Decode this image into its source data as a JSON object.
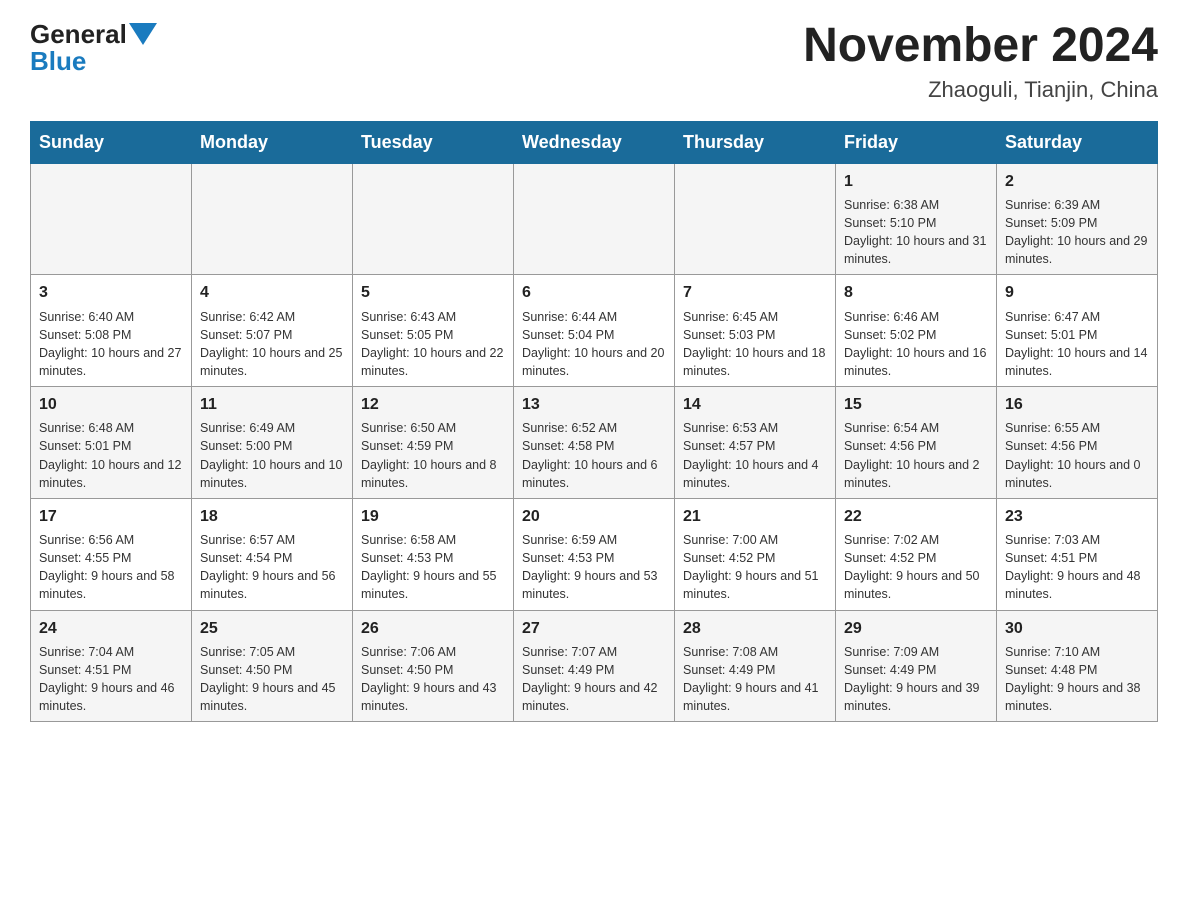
{
  "header": {
    "logo_line1": "General",
    "logo_line2": "Blue",
    "month_title": "November 2024",
    "location": "Zhaoguli, Tianjin, China"
  },
  "days_of_week": [
    "Sunday",
    "Monday",
    "Tuesday",
    "Wednesday",
    "Thursday",
    "Friday",
    "Saturday"
  ],
  "weeks": [
    [
      {
        "day": "",
        "info": ""
      },
      {
        "day": "",
        "info": ""
      },
      {
        "day": "",
        "info": ""
      },
      {
        "day": "",
        "info": ""
      },
      {
        "day": "",
        "info": ""
      },
      {
        "day": "1",
        "info": "Sunrise: 6:38 AM\nSunset: 5:10 PM\nDaylight: 10 hours and 31 minutes."
      },
      {
        "day": "2",
        "info": "Sunrise: 6:39 AM\nSunset: 5:09 PM\nDaylight: 10 hours and 29 minutes."
      }
    ],
    [
      {
        "day": "3",
        "info": "Sunrise: 6:40 AM\nSunset: 5:08 PM\nDaylight: 10 hours and 27 minutes."
      },
      {
        "day": "4",
        "info": "Sunrise: 6:42 AM\nSunset: 5:07 PM\nDaylight: 10 hours and 25 minutes."
      },
      {
        "day": "5",
        "info": "Sunrise: 6:43 AM\nSunset: 5:05 PM\nDaylight: 10 hours and 22 minutes."
      },
      {
        "day": "6",
        "info": "Sunrise: 6:44 AM\nSunset: 5:04 PM\nDaylight: 10 hours and 20 minutes."
      },
      {
        "day": "7",
        "info": "Sunrise: 6:45 AM\nSunset: 5:03 PM\nDaylight: 10 hours and 18 minutes."
      },
      {
        "day": "8",
        "info": "Sunrise: 6:46 AM\nSunset: 5:02 PM\nDaylight: 10 hours and 16 minutes."
      },
      {
        "day": "9",
        "info": "Sunrise: 6:47 AM\nSunset: 5:01 PM\nDaylight: 10 hours and 14 minutes."
      }
    ],
    [
      {
        "day": "10",
        "info": "Sunrise: 6:48 AM\nSunset: 5:01 PM\nDaylight: 10 hours and 12 minutes."
      },
      {
        "day": "11",
        "info": "Sunrise: 6:49 AM\nSunset: 5:00 PM\nDaylight: 10 hours and 10 minutes."
      },
      {
        "day": "12",
        "info": "Sunrise: 6:50 AM\nSunset: 4:59 PM\nDaylight: 10 hours and 8 minutes."
      },
      {
        "day": "13",
        "info": "Sunrise: 6:52 AM\nSunset: 4:58 PM\nDaylight: 10 hours and 6 minutes."
      },
      {
        "day": "14",
        "info": "Sunrise: 6:53 AM\nSunset: 4:57 PM\nDaylight: 10 hours and 4 minutes."
      },
      {
        "day": "15",
        "info": "Sunrise: 6:54 AM\nSunset: 4:56 PM\nDaylight: 10 hours and 2 minutes."
      },
      {
        "day": "16",
        "info": "Sunrise: 6:55 AM\nSunset: 4:56 PM\nDaylight: 10 hours and 0 minutes."
      }
    ],
    [
      {
        "day": "17",
        "info": "Sunrise: 6:56 AM\nSunset: 4:55 PM\nDaylight: 9 hours and 58 minutes."
      },
      {
        "day": "18",
        "info": "Sunrise: 6:57 AM\nSunset: 4:54 PM\nDaylight: 9 hours and 56 minutes."
      },
      {
        "day": "19",
        "info": "Sunrise: 6:58 AM\nSunset: 4:53 PM\nDaylight: 9 hours and 55 minutes."
      },
      {
        "day": "20",
        "info": "Sunrise: 6:59 AM\nSunset: 4:53 PM\nDaylight: 9 hours and 53 minutes."
      },
      {
        "day": "21",
        "info": "Sunrise: 7:00 AM\nSunset: 4:52 PM\nDaylight: 9 hours and 51 minutes."
      },
      {
        "day": "22",
        "info": "Sunrise: 7:02 AM\nSunset: 4:52 PM\nDaylight: 9 hours and 50 minutes."
      },
      {
        "day": "23",
        "info": "Sunrise: 7:03 AM\nSunset: 4:51 PM\nDaylight: 9 hours and 48 minutes."
      }
    ],
    [
      {
        "day": "24",
        "info": "Sunrise: 7:04 AM\nSunset: 4:51 PM\nDaylight: 9 hours and 46 minutes."
      },
      {
        "day": "25",
        "info": "Sunrise: 7:05 AM\nSunset: 4:50 PM\nDaylight: 9 hours and 45 minutes."
      },
      {
        "day": "26",
        "info": "Sunrise: 7:06 AM\nSunset: 4:50 PM\nDaylight: 9 hours and 43 minutes."
      },
      {
        "day": "27",
        "info": "Sunrise: 7:07 AM\nSunset: 4:49 PM\nDaylight: 9 hours and 42 minutes."
      },
      {
        "day": "28",
        "info": "Sunrise: 7:08 AM\nSunset: 4:49 PM\nDaylight: 9 hours and 41 minutes."
      },
      {
        "day": "29",
        "info": "Sunrise: 7:09 AM\nSunset: 4:49 PM\nDaylight: 9 hours and 39 minutes."
      },
      {
        "day": "30",
        "info": "Sunrise: 7:10 AM\nSunset: 4:48 PM\nDaylight: 9 hours and 38 minutes."
      }
    ]
  ]
}
